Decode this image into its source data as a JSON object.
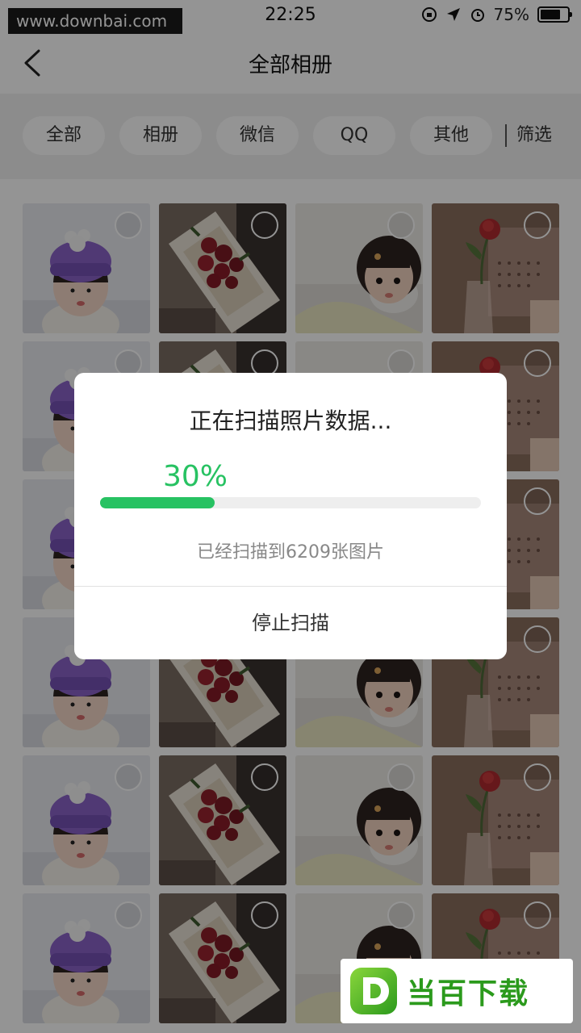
{
  "status_bar": {
    "watermark_url": "www.downbai.com",
    "time": "22:25",
    "battery": "75%",
    "battery_level": 0.75
  },
  "nav": {
    "title": "全部相册"
  },
  "filters": {
    "tabs": [
      "全部",
      "相册",
      "微信",
      "QQ",
      "其他"
    ],
    "screen_label": "筛选"
  },
  "grid": {
    "rows": 6,
    "columns": [
      "child-hat-photo",
      "rose-bouquet-photo",
      "child-lying-photo",
      "rose-vase-photo"
    ]
  },
  "dialog": {
    "title": "正在扫描照片数据...",
    "percent_text": "30%",
    "progress": 0.3,
    "detail": "已经扫描到6209张图片",
    "stop_label": "停止扫描"
  },
  "brand": {
    "text": "当百下载",
    "color": "#2b9a1c"
  },
  "colors": {
    "accent": "#27c262"
  }
}
